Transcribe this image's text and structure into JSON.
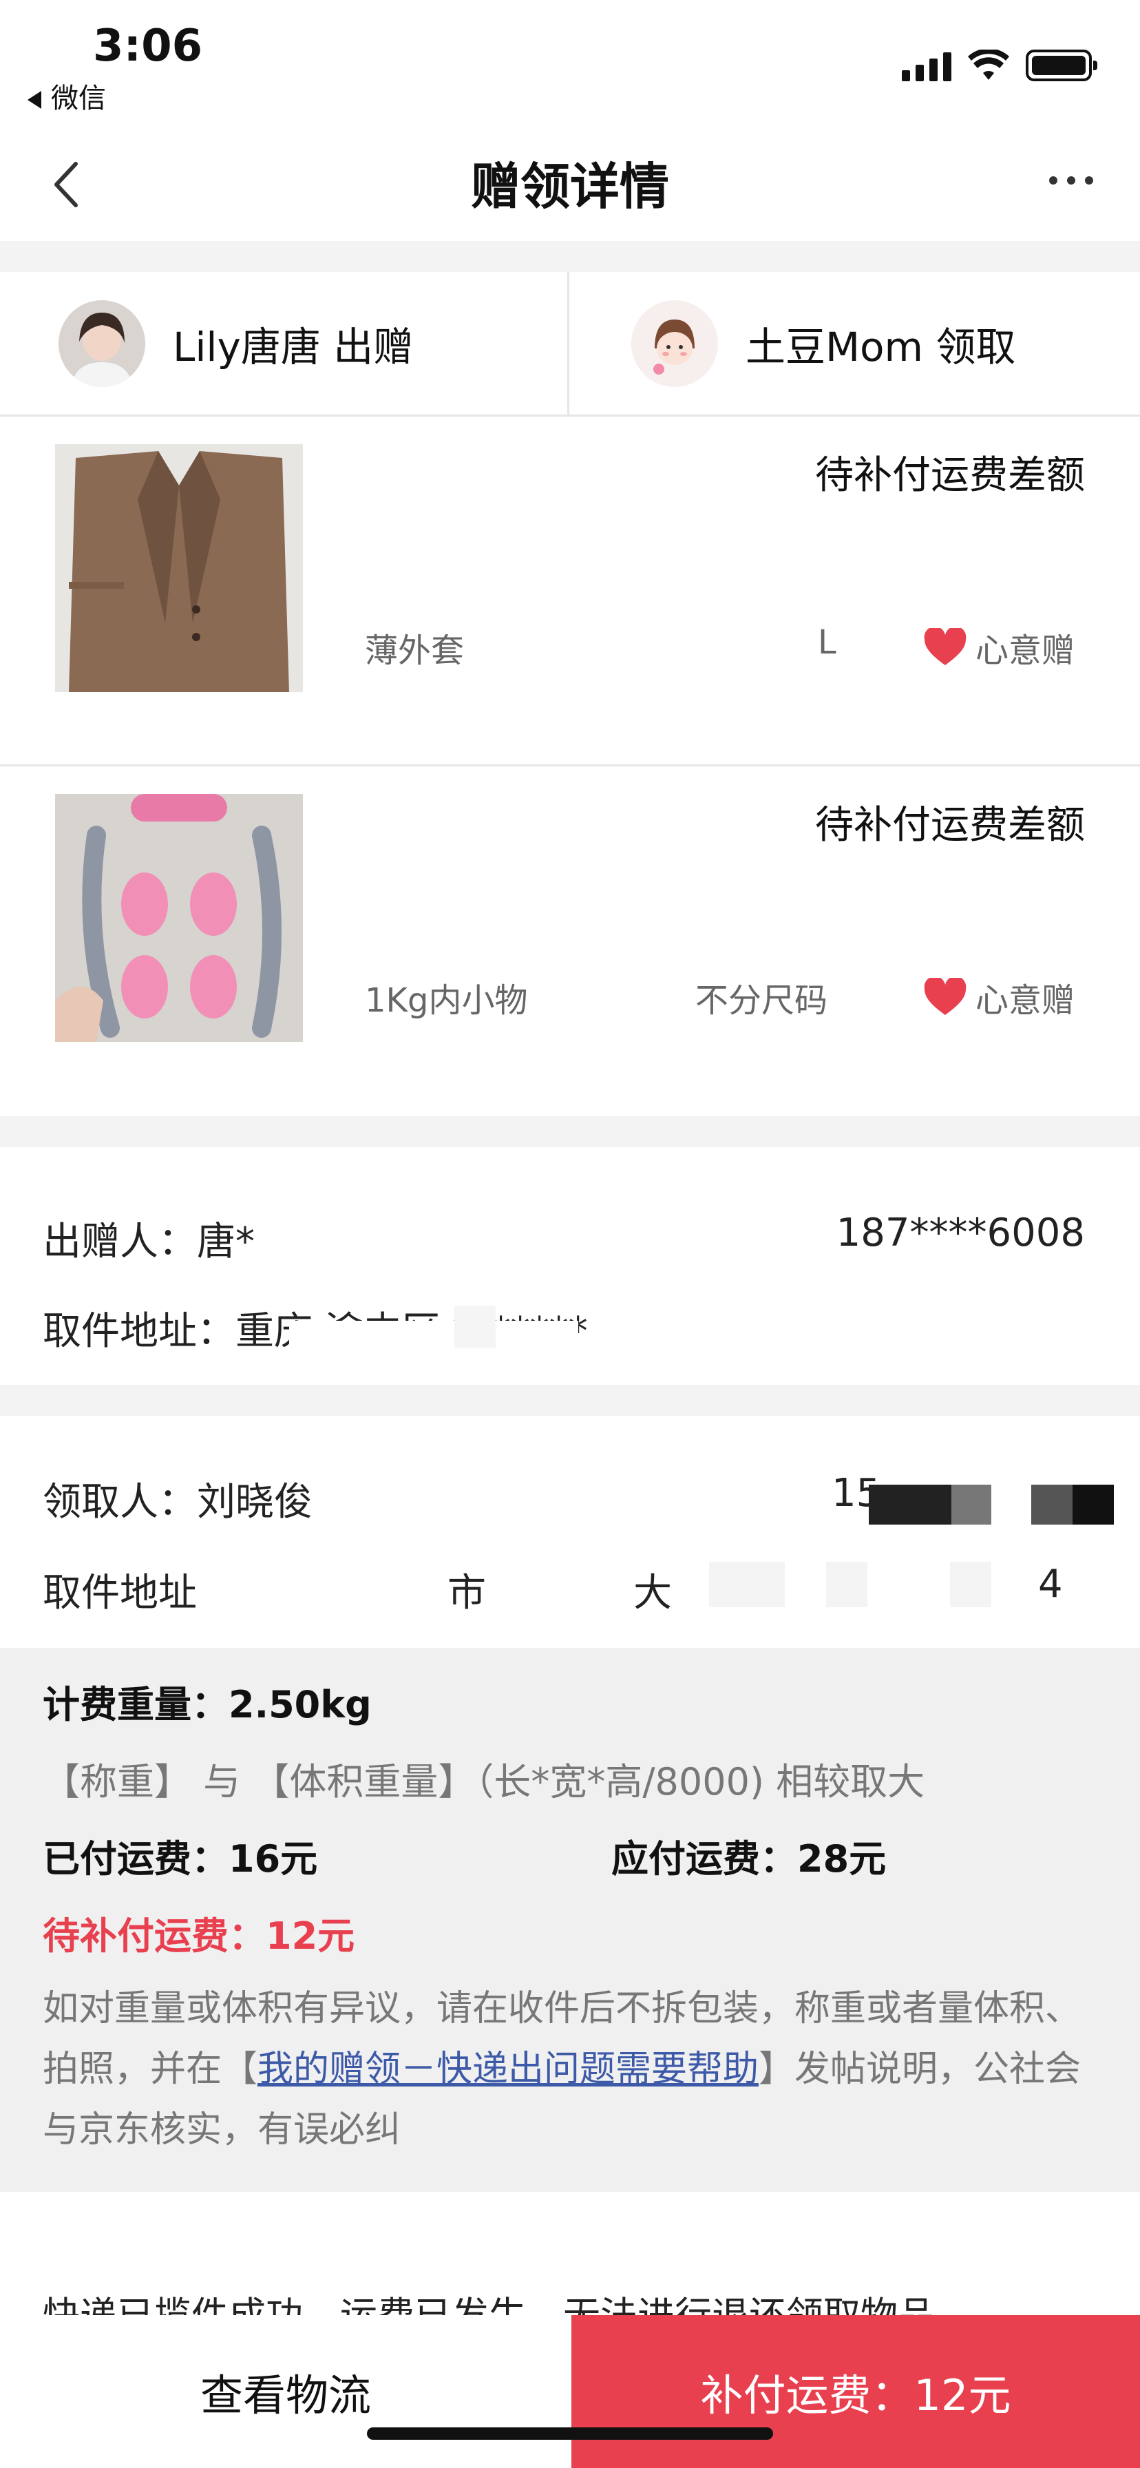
{
  "status_bar": {
    "time": "3:06",
    "back_app": "微信",
    "icons": [
      "signal-icon",
      "wifi-icon",
      "battery-icon"
    ]
  },
  "nav": {
    "title": "赠领详情",
    "back_icon": "chevron-left-icon",
    "more_icon": "more-icon"
  },
  "participants": {
    "giver": "Lily唐唐 出赠",
    "receiver": "土豆Mom 领取"
  },
  "items": [
    {
      "status": "待补付运费差额",
      "name": "薄外套",
      "size": "L",
      "tag": "心意赠"
    },
    {
      "status": "待补付运费差额",
      "name": "1Kg内小物",
      "size": "不分尺码",
      "tag": "心意赠"
    }
  ],
  "sender": {
    "label": "出赠人：唐*",
    "phone": "187****6008",
    "address": "取件地址：重庆 渝中区 *******"
  },
  "receiver_info": {
    "label": "领取人：刘晓俊",
    "phone_prefix": "15",
    "address_label": "取件地址",
    "address_fragments": [
      "市",
      "大",
      "4"
    ]
  },
  "freight": {
    "weight": "计费重量：2.50kg",
    "rule": "【称重】 与 【体积重量】（长*宽*高/8000) 相较取大",
    "paid": "已付运费：16元",
    "due": "应付运费：28元",
    "supplement": "待补付运费：12元",
    "note_before": "如对重量或体积有异议，请在收件后不拆包装，称重或者量体积、拍照，并在【",
    "note_link": "我的赠领－快递出问题需要帮助",
    "note_after": "】发帖说明，公社会与京东核实，有误必纠"
  },
  "notice": "快递已揽件成功，运费已发生，无法进行退还领取物品",
  "bottom": {
    "logistics": "查看物流",
    "pay": "补付运费：12元"
  },
  "colors": {
    "accent": "#e8404f",
    "link": "#3d5aa8",
    "background": "#f0f0f0"
  }
}
